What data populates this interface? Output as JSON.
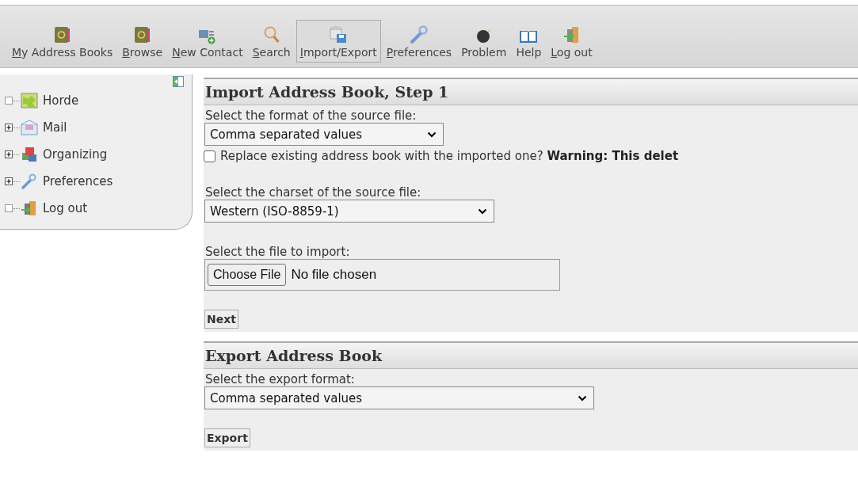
{
  "toolbar": [
    {
      "label": "My Address Books",
      "underline_first": true,
      "selected": false
    },
    {
      "label": "Browse",
      "underline_first": true,
      "selected": false
    },
    {
      "label": "New Contact",
      "underline_first": true,
      "selected": false
    },
    {
      "label": "Search",
      "underline_first": true,
      "selected": false
    },
    {
      "label": "Import/Export",
      "underline_first": true,
      "selected": true
    },
    {
      "label": "Preferences",
      "underline_first": true,
      "selected": false
    },
    {
      "label": "Problem",
      "underline_first": false,
      "selected": false
    },
    {
      "label": "Help",
      "underline_first": false,
      "selected": false
    },
    {
      "label": "Log out",
      "underline_first": true,
      "selected": false
    }
  ],
  "sidebar": {
    "items": [
      {
        "label": "Horde",
        "expandable": false
      },
      {
        "label": "Mail",
        "expandable": true
      },
      {
        "label": "Organizing",
        "expandable": true
      },
      {
        "label": "Preferences",
        "expandable": true
      },
      {
        "label": "Log out",
        "expandable": false
      }
    ]
  },
  "import": {
    "title": "Import Address Book, Step 1",
    "format_label": "Select the format of the source file:",
    "format_value": "Comma separated values",
    "replace": {
      "text": "Replace existing address book with the imported one? **Warning: This delet**",
      "checked": false
    },
    "charset_label": "Select the charset of the source file:",
    "charset_value": "Western (ISO-8859-1)",
    "file_label": "Select the file to import:",
    "file_button": "Choose File",
    "file_status": "No file chosen",
    "button": "Next"
  },
  "export": {
    "title": "Export Address Book",
    "format_label": "Select the export format:",
    "format_value": "Comma separated values",
    "button": "Export"
  }
}
